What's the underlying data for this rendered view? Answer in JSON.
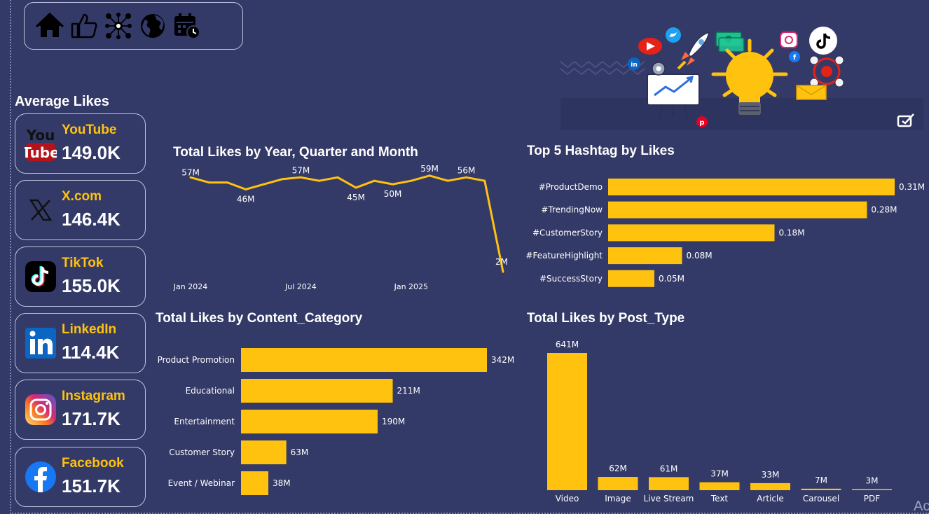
{
  "sections": {
    "average_likes_title": "Average Likes",
    "line_title": "Total Likes by Year, Quarter and Month",
    "hashtag_title": "Top 5 Hashtag by Likes",
    "category_title": "Total Likes by Content_Category",
    "posttype_title": "Total Likes by Post_Type"
  },
  "nav": {
    "icons": [
      "home-icon",
      "thumbs-up-icon",
      "network-icon",
      "globe-icon",
      "calendar-icon"
    ]
  },
  "platforms": [
    {
      "name": "YouTube",
      "value": "149.0K",
      "icon": "youtube-icon"
    },
    {
      "name": "X.com",
      "value": "146.4K",
      "icon": "x-icon"
    },
    {
      "name": "TikTok",
      "value": "155.0K",
      "icon": "tiktok-icon"
    },
    {
      "name": "LinkedIn",
      "value": "114.4K",
      "icon": "linkedin-icon"
    },
    {
      "name": "Instagram",
      "value": "171.7K",
      "icon": "instagram-icon"
    },
    {
      "name": "Facebook",
      "value": "151.7K",
      "icon": "facebook-icon"
    }
  ],
  "footer_text": "Ac",
  "colors": {
    "background": "#343a67",
    "accent": "#ffc20e",
    "text": "#ffffff"
  },
  "chart_data": [
    {
      "type": "line",
      "title": "Total Likes by Year, Quarter and Month",
      "x": [
        "2024-01",
        "2024-02",
        "2024-03",
        "2024-04",
        "2024-05",
        "2024-06",
        "2024-07",
        "2024-08",
        "2024-09",
        "2024-10",
        "2024-11",
        "2024-12",
        "2025-01",
        "2025-02",
        "2025-03",
        "2025-04",
        "2025-05",
        "2025-06"
      ],
      "values": [
        57,
        54,
        54,
        50,
        53,
        56,
        57,
        55,
        57,
        51,
        55,
        53,
        55,
        58,
        55,
        57,
        55,
        2
      ],
      "labels": [
        {
          "index": 0,
          "text": "57M"
        },
        {
          "index": 3,
          "text": "46M"
        },
        {
          "index": 6,
          "text": "57M"
        },
        {
          "index": 9,
          "text": "45M"
        },
        {
          "index": 11,
          "text": "50M"
        },
        {
          "index": 13,
          "text": "59M"
        },
        {
          "index": 15,
          "text": "56M"
        },
        {
          "index": 17,
          "text": "2M"
        }
      ],
      "x_ticks": [
        {
          "index": 0,
          "label": "Jan 2024"
        },
        {
          "index": 6,
          "label": "Jul 2024"
        },
        {
          "index": 12,
          "label": "Jan 2025"
        }
      ],
      "ylim": [
        0,
        62
      ],
      "grid": false,
      "color": "#ffc20e"
    },
    {
      "type": "bar",
      "orientation": "horizontal",
      "title": "Top 5 Hashtag by Likes",
      "categories": [
        "#ProductDemo",
        "#TrendingNow",
        "#CustomerStory",
        "#FeatureHighlight",
        "#SuccessStory"
      ],
      "values": [
        0.31,
        0.28,
        0.18,
        0.08,
        0.05
      ],
      "value_labels": [
        "0.31M",
        "0.28M",
        "0.18M",
        "0.08M",
        "0.05M"
      ],
      "xlim": [
        0,
        0.31
      ],
      "color": "#ffc20e"
    },
    {
      "type": "bar",
      "orientation": "horizontal",
      "title": "Total Likes by Content_Category",
      "categories": [
        "Product Promotion",
        "Educational",
        "Entertainment",
        "Customer Story",
        "Event / Webinar"
      ],
      "values": [
        342,
        211,
        190,
        63,
        38
      ],
      "value_labels": [
        "342M",
        "211M",
        "190M",
        "63M",
        "38M"
      ],
      "xlim": [
        0,
        342
      ],
      "color": "#ffc20e"
    },
    {
      "type": "bar",
      "orientation": "vertical",
      "title": "Total Likes by Post_Type",
      "categories": [
        "Video",
        "Image",
        "Live Stream",
        "Text",
        "Article",
        "Carousel",
        "PDF"
      ],
      "values": [
        641,
        62,
        61,
        37,
        33,
        7,
        3
      ],
      "value_labels": [
        "641M",
        "62M",
        "61M",
        "37M",
        "33M",
        "7M",
        "3M"
      ],
      "ylim": [
        0,
        641
      ],
      "color": "#ffc20e"
    }
  ]
}
